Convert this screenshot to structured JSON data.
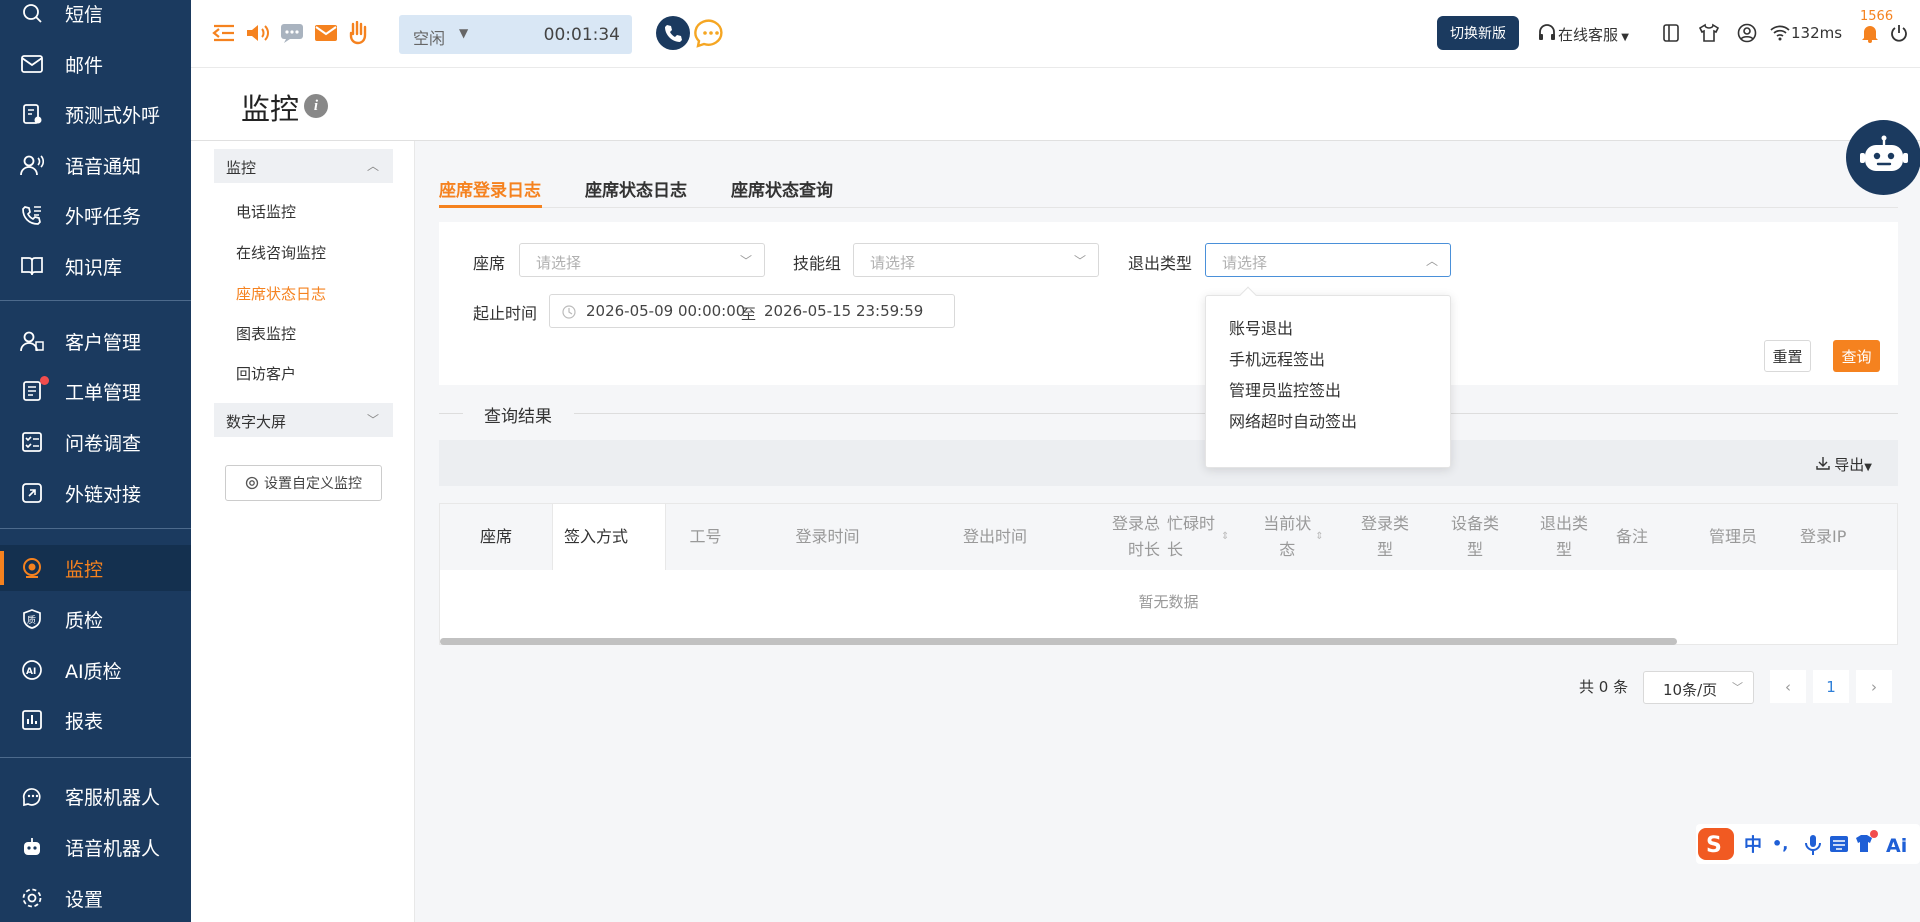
{
  "nav": {
    "items": [
      {
        "label": "短信",
        "icon": "sms-icon"
      },
      {
        "label": "邮件",
        "icon": "mail-icon"
      },
      {
        "label": "预测式外呼",
        "icon": "predictive-dial-icon"
      },
      {
        "label": "语音通知",
        "icon": "voice-notify-icon"
      },
      {
        "label": "外呼任务",
        "icon": "outbound-task-icon"
      },
      {
        "label": "知识库",
        "icon": "knowledge-base-icon"
      },
      {
        "label": "客户管理",
        "icon": "customer-icon"
      },
      {
        "label": "工单管理",
        "icon": "ticket-icon"
      },
      {
        "label": "问卷调查",
        "icon": "survey-icon"
      },
      {
        "label": "外链对接",
        "icon": "link-icon"
      },
      {
        "label": "监控",
        "icon": "monitor-icon"
      },
      {
        "label": "质检",
        "icon": "quality-icon"
      },
      {
        "label": "AI质检",
        "icon": "ai-quality-icon"
      },
      {
        "label": "报表",
        "icon": "report-icon"
      },
      {
        "label": "客服机器人",
        "icon": "chatbot-icon"
      },
      {
        "label": "语音机器人",
        "icon": "voicebot-icon"
      },
      {
        "label": "设置",
        "icon": "settings-icon"
      }
    ]
  },
  "topbar": {
    "status": "空闲",
    "timer": "00:01:34",
    "switch_label": "切换新版",
    "service_label": "在线客服",
    "latency": "132ms",
    "notification_count": "1566"
  },
  "page": {
    "title": "监控"
  },
  "subnav": {
    "group1": "监控",
    "items": [
      "电话监控",
      "在线咨询监控",
      "座席状态日志",
      "图表监控",
      "回访客户"
    ],
    "group2": "数字大屏",
    "custom_button": "设置自定义监控"
  },
  "tabs": [
    "座席登录日志",
    "座席状态日志",
    "座席状态查询"
  ],
  "filters": {
    "agent_label": "座席",
    "skill_label": "技能组",
    "exit_label": "退出类型",
    "placeholder": "请选择",
    "time_label": "起止时间",
    "start": "2026-05-09 00:00:00",
    "to": "至",
    "end": "2026-05-15 23:59:59",
    "reset": "重置",
    "query": "查询"
  },
  "dropdown": {
    "options": [
      "账号退出",
      "手机远程签出",
      "管理员监控签出",
      "网络超时自动签出"
    ]
  },
  "results": {
    "title": "查询结果",
    "export": "导出",
    "columns": [
      "座席",
      "签入方式",
      "工号",
      "登录时间",
      "登出时间",
      "登录总时长",
      "忙碌时长",
      "当前状态",
      "登录类型",
      "设备类型",
      "退出类型",
      "备注",
      "管理员",
      "登录IP"
    ],
    "empty": "暂无数据"
  },
  "pagination": {
    "total": "共 0 条",
    "page_size": "10条/页",
    "current": "1"
  },
  "colors": {
    "accent": "#f5821f",
    "nav_bg": "#1b3a5f"
  }
}
